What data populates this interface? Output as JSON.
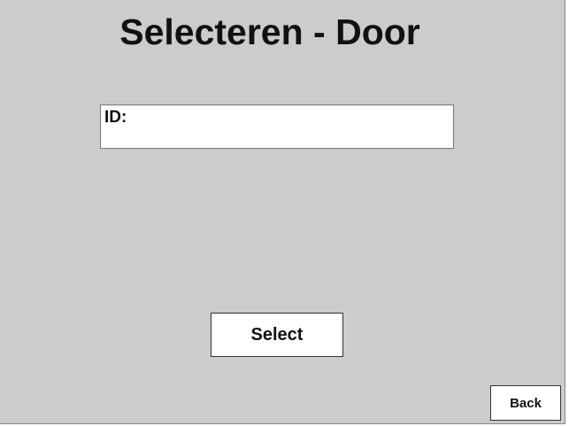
{
  "header": {
    "title": "Selecteren - Door"
  },
  "form": {
    "id_label": "ID:",
    "id_value": ""
  },
  "actions": {
    "select_label": "Select",
    "back_label": "Back"
  },
  "colors": {
    "background": "#cccccc",
    "field_background": "#ffffff",
    "button_background": "#ffffff",
    "text": "#111111"
  }
}
